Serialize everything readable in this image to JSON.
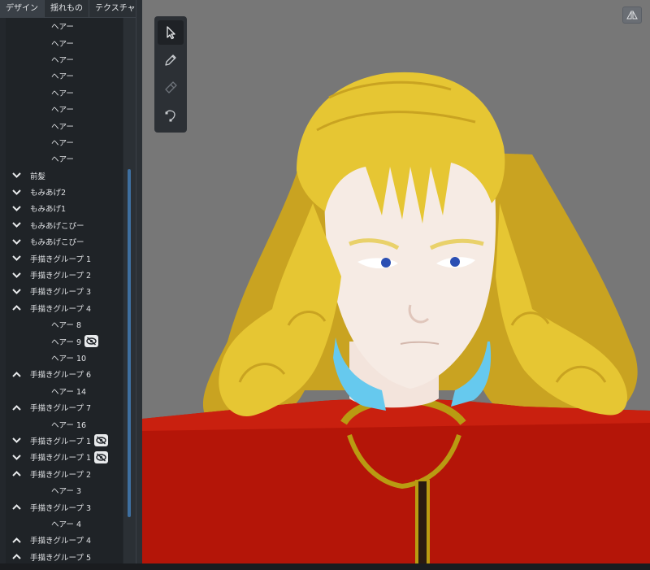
{
  "tabs": [
    {
      "label": "デザイン"
    },
    {
      "label": "揺れもの"
    },
    {
      "label": "テクスチャ"
    }
  ],
  "tree": [
    {
      "label": "ヘアー",
      "kind": "child",
      "hidden": false
    },
    {
      "label": "ヘアー",
      "kind": "child",
      "hidden": false
    },
    {
      "label": "ヘアー",
      "kind": "child",
      "hidden": false
    },
    {
      "label": "ヘアー",
      "kind": "child",
      "hidden": false
    },
    {
      "label": "ヘアー",
      "kind": "child",
      "hidden": false
    },
    {
      "label": "ヘアー",
      "kind": "child",
      "hidden": false
    },
    {
      "label": "ヘアー",
      "kind": "child",
      "hidden": false
    },
    {
      "label": "ヘアー",
      "kind": "child",
      "hidden": false
    },
    {
      "label": "ヘアー",
      "kind": "child",
      "hidden": false
    },
    {
      "label": "前髪",
      "kind": "group",
      "expanded": false,
      "hidden": false
    },
    {
      "label": "もみあげ2",
      "kind": "group",
      "expanded": false,
      "hidden": false
    },
    {
      "label": "もみあげ1",
      "kind": "group",
      "expanded": false,
      "hidden": false
    },
    {
      "label": "もみあげこぴー",
      "kind": "group",
      "expanded": false,
      "hidden": false
    },
    {
      "label": "もみあげこぴー",
      "kind": "group",
      "expanded": false,
      "hidden": false
    },
    {
      "label": "手描きグループ 1",
      "kind": "group",
      "expanded": false,
      "hidden": false
    },
    {
      "label": "手描きグループ 2",
      "kind": "group",
      "expanded": false,
      "hidden": false
    },
    {
      "label": "手描きグループ 3",
      "kind": "group",
      "expanded": false,
      "hidden": false
    },
    {
      "label": "手描きグループ 4",
      "kind": "group",
      "expanded": true,
      "hidden": false
    },
    {
      "label": "ヘアー 8",
      "kind": "child",
      "hidden": false
    },
    {
      "label": "ヘアー 9",
      "kind": "child",
      "hidden": true
    },
    {
      "label": "ヘアー 10",
      "kind": "child",
      "hidden": false
    },
    {
      "label": "手描きグループ 6",
      "kind": "group",
      "expanded": true,
      "hidden": false
    },
    {
      "label": "ヘアー 14",
      "kind": "child",
      "hidden": false
    },
    {
      "label": "手描きグループ 7",
      "kind": "group",
      "expanded": true,
      "hidden": false
    },
    {
      "label": "ヘアー 16",
      "kind": "child",
      "hidden": false
    },
    {
      "label": "手描きグループ 1",
      "kind": "group",
      "expanded": false,
      "hidden": true
    },
    {
      "label": "手描きグループ 1",
      "kind": "group",
      "expanded": false,
      "hidden": true
    },
    {
      "label": "手描きグループ 2",
      "kind": "group",
      "expanded": true,
      "hidden": false
    },
    {
      "label": "ヘアー 3",
      "kind": "child",
      "hidden": false
    },
    {
      "label": "手描きグループ 3",
      "kind": "group",
      "expanded": true,
      "hidden": false
    },
    {
      "label": "ヘアー 4",
      "kind": "child",
      "hidden": false
    },
    {
      "label": "手描きグループ 4",
      "kind": "group",
      "expanded": true,
      "hidden": false
    },
    {
      "label": "手描きグループ 5",
      "kind": "group",
      "expanded": true,
      "hidden": false
    }
  ],
  "tools": [
    {
      "name": "select-tool",
      "icon": "cursor-arrow-icon",
      "active": true
    },
    {
      "name": "pen-tool",
      "icon": "pencil-icon",
      "active": false
    },
    {
      "name": "eraser-tool",
      "icon": "eraser-icon",
      "active": false
    },
    {
      "name": "curve-tool",
      "icon": "bezier-curve-icon",
      "active": false
    }
  ],
  "viewport": {
    "background": "#777777",
    "mirror_icon": "mirror-symmetry-icon"
  },
  "colors": {
    "panel_bg": "#23272c",
    "tree_bg": "#1f2327",
    "accent_scroll": "#3e6fa0",
    "hair": "#e6c633",
    "jacket": "#b41508",
    "collar": "#66c9ee",
    "trim": "#b99b12"
  }
}
